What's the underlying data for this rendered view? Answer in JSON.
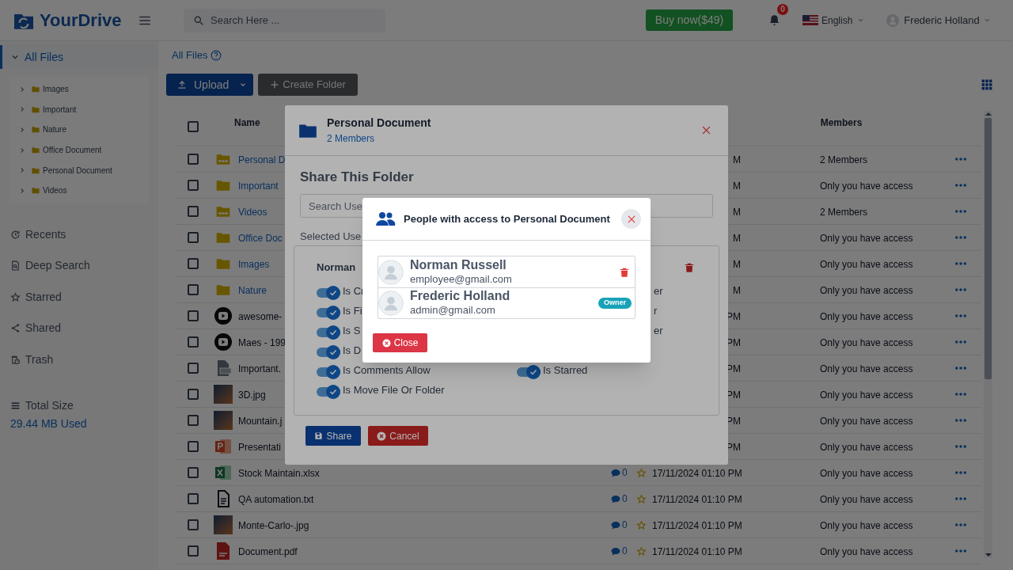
{
  "header": {
    "logo": "YourDrive",
    "search": {
      "placeholder": "Search Here ..."
    },
    "buy_button": "Buy now($49)",
    "notifications": "0",
    "language": "English",
    "user": "Frederic Holland"
  },
  "sidebar": {
    "tree": {
      "label": "All Files",
      "expanded": true,
      "selected": true,
      "children": [
        {
          "label": "Images",
          "expanded": false
        },
        {
          "label": "Important",
          "expanded": false
        },
        {
          "label": "Nature",
          "expanded": false
        },
        {
          "label": "Office Document",
          "expanded": false
        },
        {
          "label": "Personal Document",
          "expanded": false
        },
        {
          "label": "Videos",
          "expanded": false
        }
      ]
    },
    "items": [
      {
        "label": "Recents",
        "kind": "recents",
        "selected": false
      },
      {
        "label": "Deep Search",
        "kind": "search",
        "selected": false
      },
      {
        "label": "Starred",
        "kind": "starred",
        "selected": false
      },
      {
        "label": "Shared",
        "kind": "shared",
        "selected": false
      },
      {
        "label": "Trash",
        "kind": "trash",
        "selected": false
      }
    ],
    "total_size": {
      "label": "Total Size",
      "value": "29.44 MB Used"
    }
  },
  "main": {
    "breadcrumb": "All Files",
    "upload_button": "Upload",
    "create_folder_button": "Create Folder"
  },
  "table": {
    "header_checked": false,
    "columns": [
      "Name",
      "Members"
    ],
    "rows": [
      {
        "kind": "shared-folder",
        "checked": false,
        "name": "Personal D",
        "date": "M",
        "members": "2 Members"
      },
      {
        "kind": "folder",
        "checked": false,
        "name": "Important",
        "date": "M",
        "members": "Only you have access"
      },
      {
        "kind": "shared-folder",
        "checked": false,
        "name": "Videos",
        "date": "M",
        "members": "2 Members"
      },
      {
        "kind": "folder",
        "checked": false,
        "name": "Office Doc",
        "date": "M",
        "members": "Only you have access"
      },
      {
        "kind": "folder",
        "checked": false,
        "name": "Images",
        "date": "M",
        "members": "Only you have access"
      },
      {
        "kind": "folder",
        "checked": false,
        "name": "Nature",
        "date": "M",
        "members": "Only you have access"
      },
      {
        "kind": "video",
        "checked": false,
        "name": "awesome-",
        "date": "PM",
        "members": "Only you have access"
      },
      {
        "kind": "video",
        "checked": false,
        "name": "Maes - 199",
        "date": "PM",
        "members": "Only you have access"
      },
      {
        "kind": "zip",
        "checked": false,
        "name": "Important.",
        "date": "PM",
        "members": "Only you have access"
      },
      {
        "kind": "image",
        "checked": false,
        "name": "3D.jpg",
        "date": "PM",
        "members": "Only you have access"
      },
      {
        "kind": "image",
        "checked": false,
        "name": "Mountain.j",
        "date": "PM",
        "members": "Only you have access"
      },
      {
        "kind": "ppt",
        "checked": false,
        "name": "Presentati",
        "date": "PM",
        "members": "Only you have access"
      },
      {
        "kind": "xlsx",
        "checked": false,
        "name": "Stock Maintain.xlsx",
        "comments": "0",
        "starred": false,
        "date": "17/11/2024 01:10 PM",
        "members": "Only you have access"
      },
      {
        "kind": "text",
        "checked": false,
        "name": "QA automation.txt",
        "comments": "0",
        "starred": false,
        "date": "17/11/2024 01:10 PM",
        "members": "Only you have access"
      },
      {
        "kind": "image",
        "checked": false,
        "name": "Monte-Carlo-.jpg",
        "comments": "0",
        "starred": false,
        "date": "17/11/2024 01:10 PM",
        "members": "Only you have access"
      },
      {
        "kind": "pdf",
        "checked": false,
        "name": "Document.pdf",
        "comments": "0",
        "starred": false,
        "date": "17/11/2024 01:10 PM",
        "members": "Only you have access"
      }
    ]
  },
  "share_dialog": {
    "title": "Personal Document",
    "subtitle": "2 Members",
    "heading": "Share This Folder",
    "search": {
      "placeholder": "Search Use"
    },
    "selected_label": "Selected Use",
    "user": "Norman",
    "permissions": [
      {
        "left": {
          "label": "Is Cr",
          "on": true
        },
        "right": {
          "label": "er"
        }
      },
      {
        "left": {
          "label": "Is Fi",
          "on": true
        },
        "right": {
          "label": "r"
        }
      },
      {
        "left": {
          "label": "Is S",
          "on": true
        },
        "right": {
          "label": "er"
        }
      },
      {
        "left": {
          "label": "Is D",
          "on": true
        }
      },
      {
        "left": {
          "label": "Is Comments Allow",
          "on": true
        },
        "right": {
          "label": "Is Starred",
          "on": true
        }
      },
      {
        "left": {
          "label": "Is Move File Or Folder",
          "on": true
        }
      }
    ],
    "buttons": [
      {
        "label": "Share",
        "kind": "primary"
      },
      {
        "label": "Cancel",
        "kind": "danger"
      }
    ]
  },
  "access_dialog": {
    "title": "People with access to Personal Document",
    "members": [
      {
        "name": "Norman Russell",
        "email": "employee@gmail.com",
        "kind": "member"
      },
      {
        "name": "Frederic Holland",
        "email": "admin@gmail.com",
        "kind": "owner",
        "badge": "Owner"
      }
    ],
    "close_button": "Close"
  }
}
